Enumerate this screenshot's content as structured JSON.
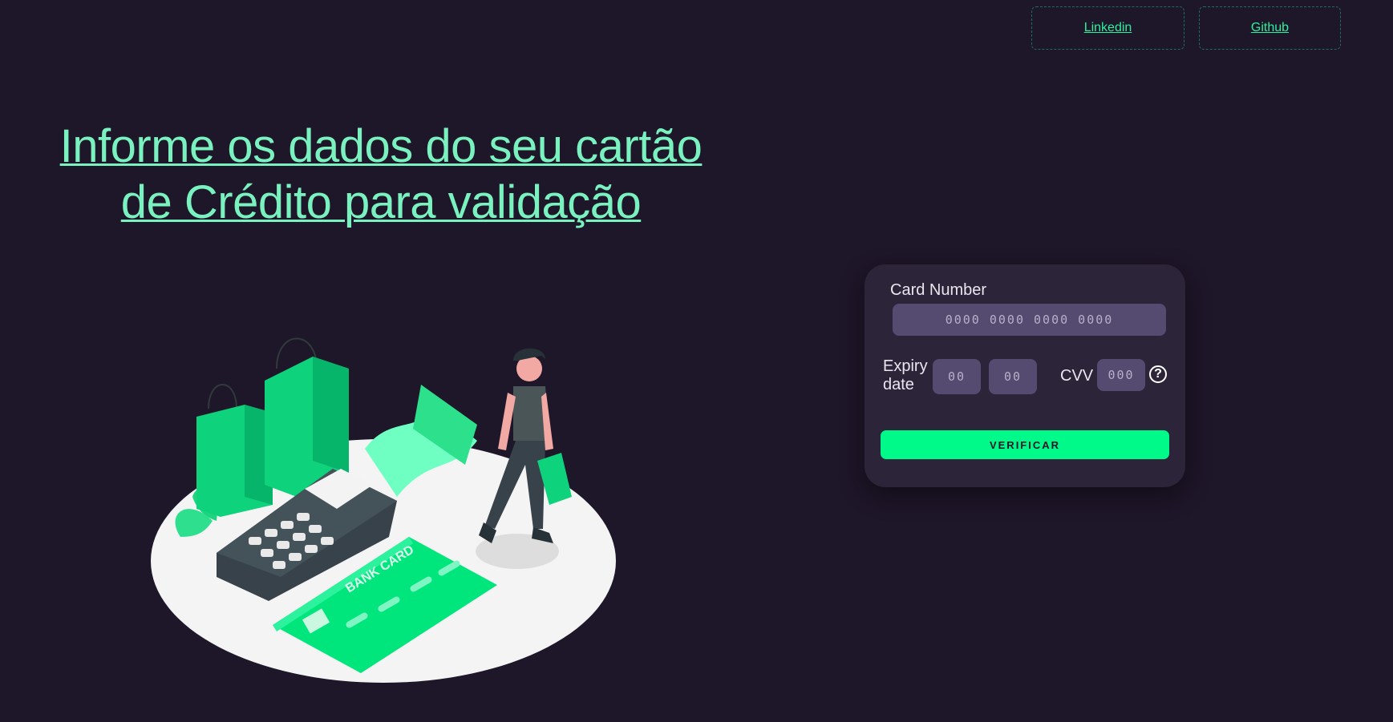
{
  "nav": {
    "linkedin_label": "Linkedin",
    "github_label": "Github"
  },
  "headline": {
    "line1": "Informe os dados do seu cartão",
    "line2": "de Crédito para validação"
  },
  "illustration": {
    "card_text": "BANK CARD"
  },
  "form": {
    "card_number_label": "Card Number",
    "card_number_placeholder": "0000 0000 0000 0000",
    "expiry_label_line1": "Expiry",
    "expiry_label_line2": "date",
    "expiry_month_placeholder": "00",
    "expiry_year_placeholder": "00",
    "cvv_label": "CVV",
    "cvv_placeholder": "000",
    "help_glyph": "?",
    "verify_label": "VERIFICAR"
  },
  "colors": {
    "background": "#1e1629",
    "accent": "#00fa8a",
    "headline": "#79f2bf",
    "panel": "#2c2539",
    "field": "#554a70"
  }
}
